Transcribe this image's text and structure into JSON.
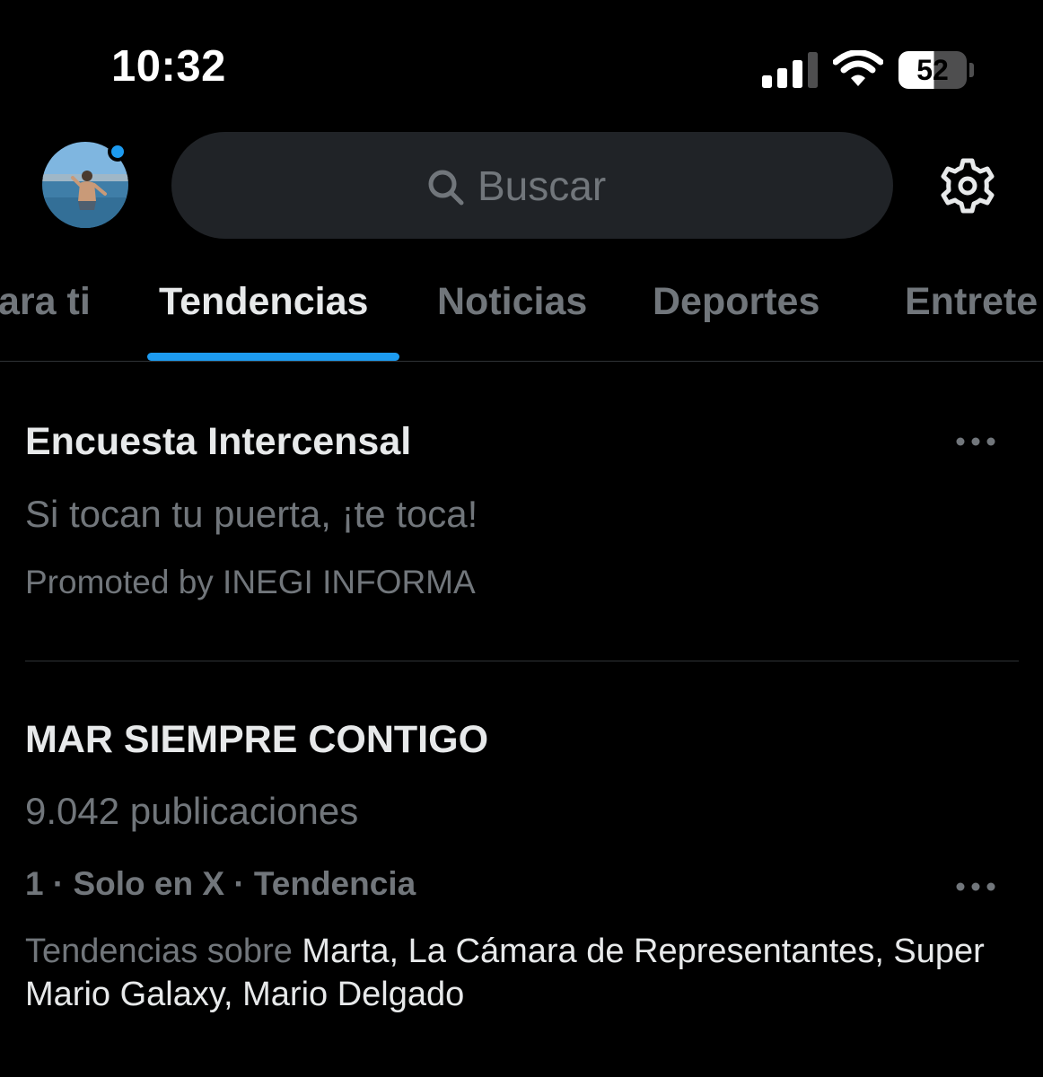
{
  "status_bar": {
    "time": "10:32",
    "battery_level": "52",
    "signal_bars": 4,
    "signal_bars_active": 3
  },
  "header": {
    "search_placeholder": "Buscar",
    "avatar_has_notification": true,
    "accent_color": "#1d9bf0"
  },
  "tabs": [
    {
      "label": "ara ti",
      "active": false
    },
    {
      "label": "Tendencias",
      "active": true
    },
    {
      "label": "Noticias",
      "active": false
    },
    {
      "label": "Deportes",
      "active": false
    },
    {
      "label": "Entrete",
      "active": false
    }
  ],
  "trends": [
    {
      "title": "Encuesta Intercensal",
      "subtitle": "Si tocan tu puerta, ¡te toca!",
      "meta": "Promoted by INEGI INFORMA"
    },
    {
      "title": "MAR SIEMPRE CONTIGO",
      "posts": "9.042 publicaciones",
      "meta": "1 · Solo en X · Tendencia",
      "related_prefix": "Tendencias sobre",
      "related_topics": "Marta, La Cámara de Representantes, Super Mario Galaxy, Mario Delgado"
    }
  ],
  "icons": {
    "search": "search-icon",
    "settings": "gear-icon",
    "more": "more-horizontal-icon",
    "wifi": "wifi-icon",
    "signal": "signal-icon",
    "battery": "battery-icon"
  }
}
